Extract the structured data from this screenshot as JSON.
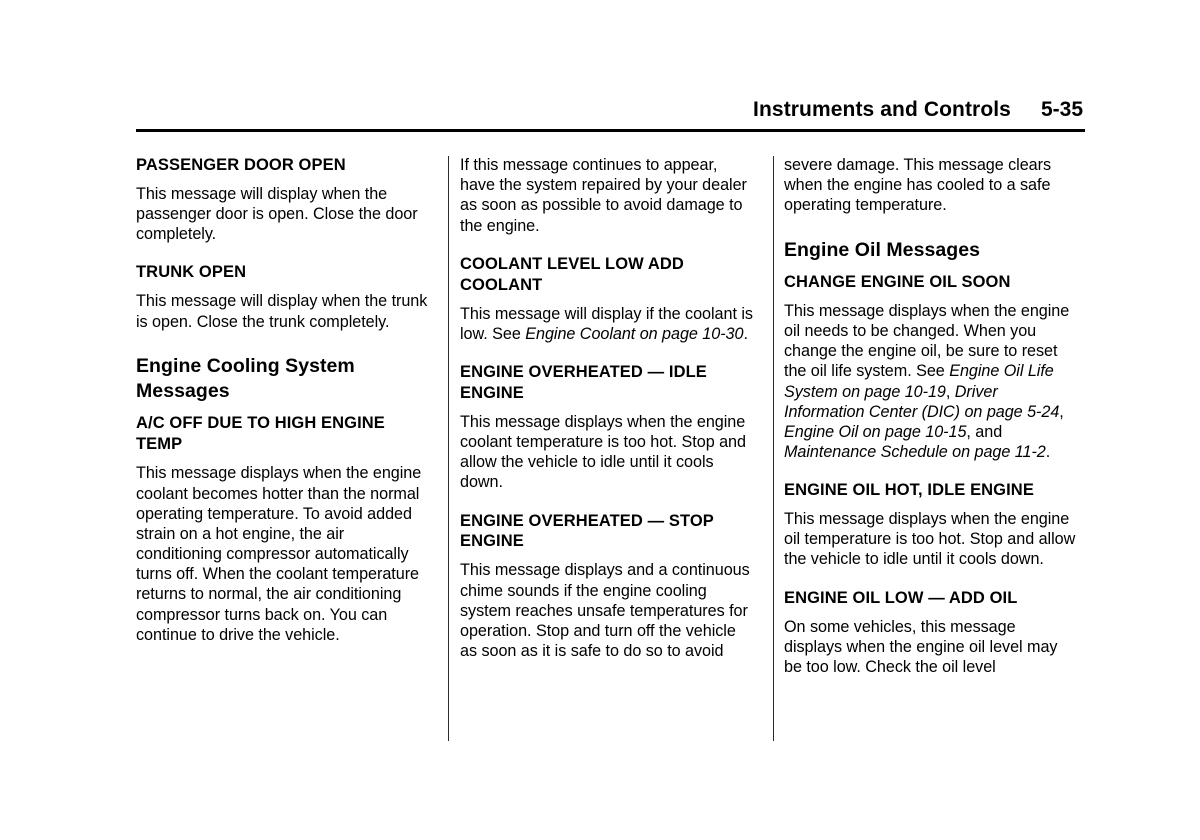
{
  "header": {
    "title": "Instruments and Controls",
    "folio": "5-35"
  },
  "columns": [
    {
      "id": "column-1",
      "blocks": [
        {
          "type": "h2",
          "text": "PASSENGER DOOR OPEN"
        },
        {
          "type": "p",
          "text": "This message will display when the passenger door is open. Close the door completely."
        },
        {
          "type": "h2",
          "text": "TRUNK OPEN"
        },
        {
          "type": "p",
          "text": "This message will display when the trunk is open. Close the trunk completely."
        },
        {
          "type": "h1",
          "text": "Engine Cooling System Messages"
        },
        {
          "type": "h2",
          "text": "A/C OFF DUE TO HIGH ENGINE TEMP"
        },
        {
          "type": "p",
          "text": "This message displays when the engine coolant becomes hotter than the normal operating temperature. To avoid added strain on a hot engine, the air conditioning compressor automatically turns off. When the coolant temperature returns to normal, the air conditioning compressor turns back on. You can continue to drive the vehicle."
        }
      ]
    },
    {
      "id": "column-2",
      "blocks": [
        {
          "type": "p",
          "text": "If this message continues to appear, have the system repaired by your dealer as soon as possible to avoid damage to the engine."
        },
        {
          "type": "h2",
          "text": "COOLANT LEVEL LOW ADD COOLANT"
        },
        {
          "type": "p_rich",
          "runs": [
            {
              "style": "normal",
              "text": "This message will display if the coolant is low. See "
            },
            {
              "style": "italic",
              "text": "Engine Coolant on page 10-30"
            },
            {
              "style": "normal",
              "text": "."
            }
          ]
        },
        {
          "type": "h2",
          "text": "ENGINE OVERHEATED — IDLE ENGINE"
        },
        {
          "type": "p",
          "text": "This message displays when the engine coolant temperature is too hot. Stop and allow the vehicle to idle until it cools down."
        },
        {
          "type": "h2",
          "text": "ENGINE OVERHEATED — STOP ENGINE"
        },
        {
          "type": "p",
          "text": "This message displays and a continuous chime sounds if the engine cooling system reaches unsafe temperatures for operation. Stop and turn off the vehicle as soon as it is safe to do so to avoid"
        }
      ]
    },
    {
      "id": "column-3",
      "blocks": [
        {
          "type": "p",
          "text": "severe damage. This message clears when the engine has cooled to a safe operating temperature."
        },
        {
          "type": "h1",
          "text": "Engine Oil Messages"
        },
        {
          "type": "h2",
          "text": "CHANGE ENGINE OIL SOON"
        },
        {
          "type": "p_rich",
          "runs": [
            {
              "style": "normal",
              "text": "This message displays when the engine oil needs to be changed. When you change the engine oil, be sure to reset the oil life system. See "
            },
            {
              "style": "italic",
              "text": "Engine Oil Life System on page 10-19"
            },
            {
              "style": "normal",
              "text": ", "
            },
            {
              "style": "italic",
              "text": "Driver Information Center (DIC) on page 5-24"
            },
            {
              "style": "normal",
              "text": ", "
            },
            {
              "style": "italic",
              "text": "Engine Oil on page 10-15"
            },
            {
              "style": "normal",
              "text": ", and "
            },
            {
              "style": "italic",
              "text": "Maintenance Schedule on page 11-2"
            },
            {
              "style": "normal",
              "text": "."
            }
          ]
        },
        {
          "type": "h2",
          "text": "ENGINE OIL HOT, IDLE ENGINE"
        },
        {
          "type": "p",
          "text": "This message displays when the engine oil temperature is too hot. Stop and allow the vehicle to idle until it cools down."
        },
        {
          "type": "h2",
          "text": "ENGINE OIL LOW — ADD OIL"
        },
        {
          "type": "p",
          "text": "On some vehicles, this message displays when the engine oil level may be too low. Check the oil level"
        }
      ]
    }
  ]
}
